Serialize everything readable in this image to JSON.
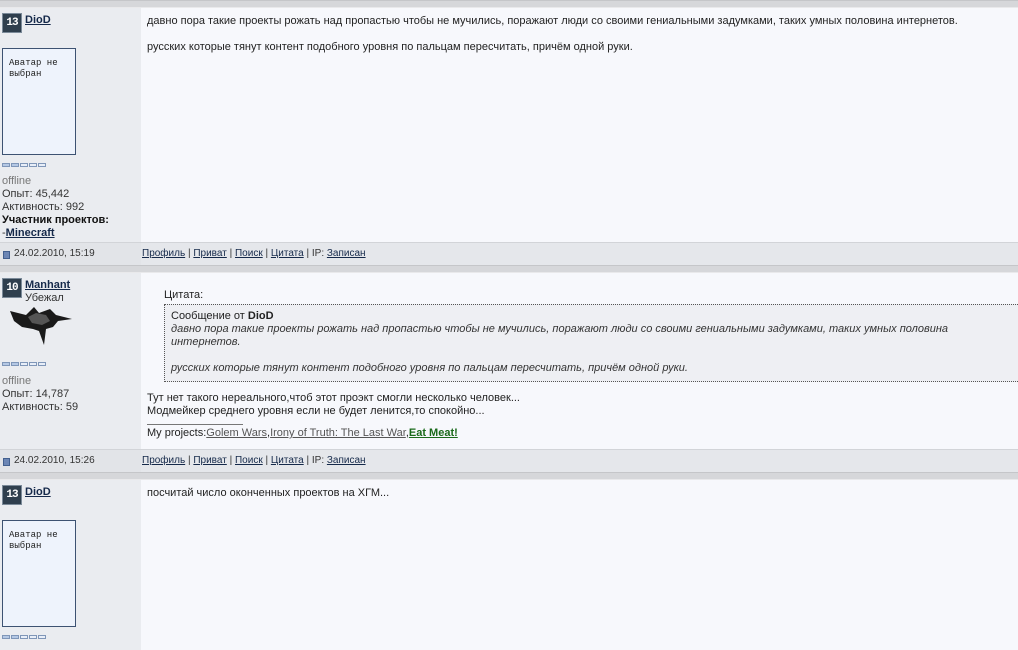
{
  "posts": [
    {
      "username": "DioD",
      "level": "13",
      "avatar_text": "Аватар не выбран",
      "status": "offline",
      "experience": "Опыт: 45,442",
      "activity": "Активность: 992",
      "projects_label": "Участник проектов:",
      "projects_prefix": "-",
      "project": "Minecraft",
      "message_lines": [
        "давно пора такие проекты рожать над пропастью чтобы не мучились, поражают люди со своими гениальными задумками, таких умных половина интернетов.",
        "русских которые тянут контент подобного уровня по пальцам пересчитать, причём одной руки."
      ],
      "date": "24.02.2010, 15:19"
    },
    {
      "username": "Manhant",
      "user_title": "Убежал",
      "level": "10",
      "status": "offline",
      "experience": "Опыт: 14,787",
      "activity": "Активность: 59",
      "quote": {
        "title": "Цитата:",
        "from_prefix": "Сообщение от ",
        "from_user": "DioD",
        "lines": [
          "давно пора такие проекты рожать над пропастью чтобы не мучились, поражают люди со своими гениальными задумками, таких умных половина интернетов.",
          "русских которые тянут контент подобного уровня по пальцам пересчитать, причём одной руки."
        ]
      },
      "message_lines": [
        "Тут нет такого нереального,чтоб этот проэкт смогли несколько человек...",
        "Модмейкер среднего уровня если не будет ленится,то спокойно..."
      ],
      "signature": {
        "prefix": "My projects:",
        "p1": "Golem Wars",
        "sep1": ",",
        "p2": "Irony of Truth: The Last War",
        "sep2": ",",
        "p3": "Eat Meat!"
      },
      "date": "24.02.2010, 15:26"
    },
    {
      "username": "DioD",
      "level": "13",
      "avatar_text": "Аватар не выбран",
      "message_lines": [
        "посчитай число оконченных проектов на ХГМ..."
      ]
    }
  ],
  "footer_links": {
    "profile": "Профиль",
    "pm": "Приват",
    "search": "Поиск",
    "quote": "Цитата",
    "ip_label": "IP:",
    "ip_value": "Записан",
    "divider": "|"
  },
  "colors": {
    "left_bg": "#eaecf0",
    "right_bg": "#f7f8fc",
    "link": "#15294a",
    "green_link": "#1a6a1a"
  }
}
